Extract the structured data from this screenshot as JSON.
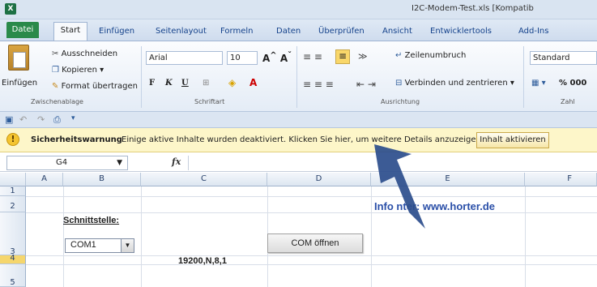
{
  "window": {
    "title": "I2C-Modem-Test.xls [Kompatib"
  },
  "tabs": [
    {
      "label": "Datei"
    },
    {
      "label": "Start"
    },
    {
      "label": "Einfügen"
    },
    {
      "label": "Seitenlayout"
    },
    {
      "label": "Formeln"
    },
    {
      "label": "Daten"
    },
    {
      "label": "Überprüfen"
    },
    {
      "label": "Ansicht"
    },
    {
      "label": "Entwicklertools"
    },
    {
      "label": "Add-Ins"
    }
  ],
  "ribbon": {
    "clipboard": {
      "paste_label": "Einfügen",
      "cut_label": "Ausschneiden",
      "copy_label": "Kopieren ▾",
      "format_painter_label": "Format übertragen",
      "group_label": "Zwischenablage"
    },
    "font": {
      "font_name": "Arial",
      "font_size": "10",
      "group_label": "Schriftart"
    },
    "alignment": {
      "wrap_label": "Zeilenumbruch",
      "merge_label": "Verbinden und zentrieren ▾",
      "group_label": "Ausrichtung"
    },
    "number": {
      "format_value": "Standard",
      "percent_label": "% 000",
      "group_label": "Zahl"
    }
  },
  "security_bar": {
    "title": "Sicherheitswarnung",
    "message": "Einige aktive Inhalte wurden deaktiviert. Klicken Sie hier, um weitere Details anzuzeigen.",
    "button_label": "Inhalt aktivieren",
    "icon": "warning-icon"
  },
  "formula_bar": {
    "name_box": "G4",
    "fx_label": "fx",
    "formula": ""
  },
  "grid": {
    "columns": [
      "A",
      "B",
      "C",
      "D",
      "E",
      "F"
    ],
    "rows": [
      "1",
      "2",
      "3",
      "4",
      "5"
    ]
  },
  "sheet": {
    "schnittstelle_label": "Schnittstelle:",
    "com_port_value": "COM1",
    "serial_params": "19200,N,8,1",
    "open_button_label": "COM öffnen",
    "info_text": "Info    nter: www.horter.de"
  },
  "colors": {
    "arrow": "#2b4d8c",
    "security_bar": "#fdf6c9",
    "file_tab": "#2a8a4a",
    "info_text": "#2a4fa8"
  }
}
